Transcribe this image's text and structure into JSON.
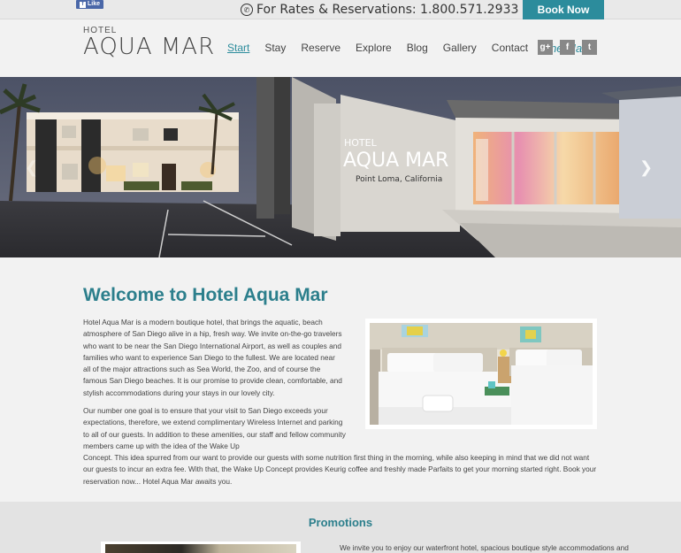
{
  "topbar": {
    "fb_like_label": "Like",
    "reservations_text": "For Rates & Reservations: 1.800.571.2933",
    "book_now_label": "Book Now"
  },
  "logo": {
    "line1": "HOTEL",
    "line2": "AQUA MAR"
  },
  "nav": {
    "items": [
      "Start",
      "Stay",
      "Reserve",
      "Explore",
      "Blog",
      "Gallery",
      "Contact"
    ],
    "special": "The Mar"
  },
  "social": {
    "google": "g+",
    "facebook": "f",
    "twitter": "t"
  },
  "hero": {
    "sign_line1": "HOTEL",
    "sign_line2": "AQUA MAR",
    "sign_line3": "Point Loma, California",
    "prev_glyph": "❮",
    "next_glyph": "❯"
  },
  "welcome": {
    "title": "Welcome to Hotel Aqua Mar",
    "para1": "Hotel Aqua Mar is a modern boutique hotel, that brings the aquatic, beach atmosphere of San Diego alive in a hip, fresh way. We invite on-the-go travelers who want to be near the San Diego International Airport, as well as couples and families who want to experience San Diego to the fullest. We are located near all of the major attractions such as Sea World, the Zoo, and of course the famous San Diego beaches. It is our promise to provide clean, comfortable, and stylish accommodations during your stays in our lovely city.",
    "para2_narrow": "Our number one goal is to ensure that your visit to San Diego exceeds your expectations, therefore, we extend complimentary Wireless Internet and parking to all of our guests. In addition to these amenities, our staff and fellow community members came up with the idea of the Wake Up",
    "para2_wide": "Concept. This idea spurred from our want to provide our guests with some nutrition first thing in the morning, while also keeping in mind that we did not want our guests to incur an extra fee. With that, the Wake Up Concept provides Keurig coffee and freshly made Parfaits to get your morning started right. Book your reservation now... Hotel Aqua Mar awaits you."
  },
  "promotions": {
    "title": "Promotions",
    "text": "We invite you to enjoy our waterfront hotel, spacious boutique style accommodations and"
  },
  "colors": {
    "accent": "#2c8c9c",
    "heading": "#2c7f8c"
  }
}
